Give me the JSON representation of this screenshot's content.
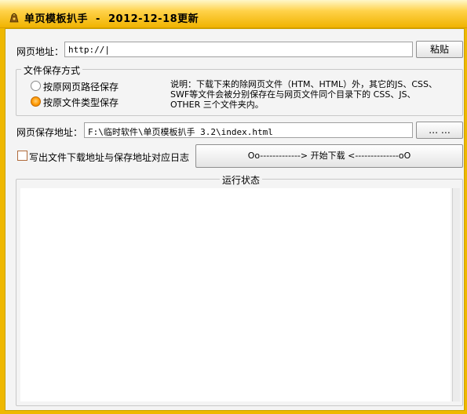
{
  "window": {
    "title": "单页模板扒手  -  2012-12-18更新"
  },
  "url_row": {
    "label": "网页地址：",
    "value": "http://|",
    "paste_button": "粘贴"
  },
  "save_mode": {
    "group_title": "文件保存方式",
    "options": [
      {
        "label": "按原网页路径保存",
        "selected": false
      },
      {
        "label": "按原文件类型保存",
        "selected": true
      }
    ],
    "description_lines": [
      "说明：下载下来的除网页文件（HTM、HTML）外，其它的JS、CSS、",
      "SWF等文件会被分别保存在与网页文件同个目录下的 CSS、JS、",
      "OTHER 三个文件夹内。"
    ]
  },
  "save_path_row": {
    "label": "网页保存地址：",
    "value": "F:\\临时软件\\单页模板扒手 3.2\\index.html",
    "browse_button": "… …"
  },
  "log_option": {
    "label": "写出文件下载地址与保存地址对应日志",
    "checked": false
  },
  "start_button": {
    "label": "Oo-------------> 开始下载 <--------------oO"
  },
  "status_group": {
    "title": "运行状态",
    "log_text": ""
  },
  "colors": {
    "title_bar": "#f0b300",
    "selected_radio": "#ff9a00"
  }
}
